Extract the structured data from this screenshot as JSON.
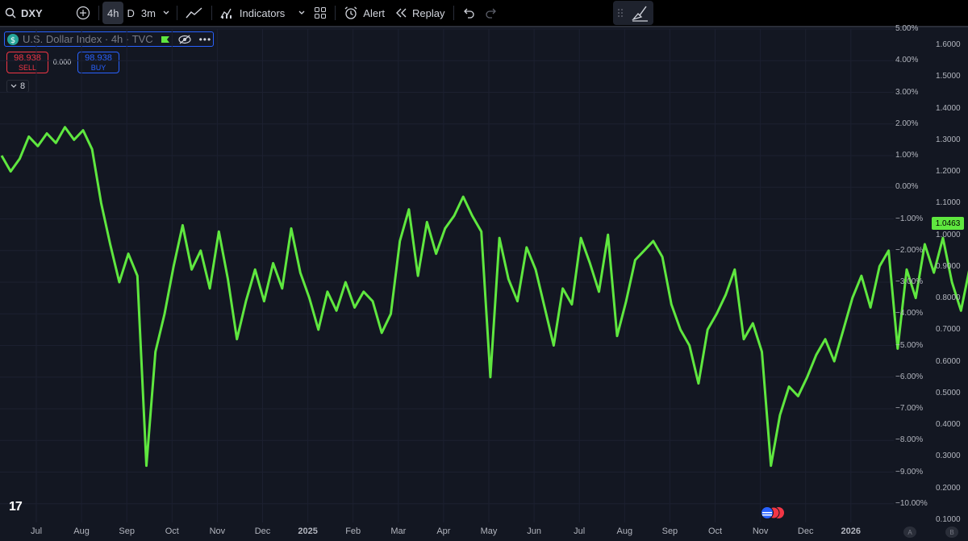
{
  "toolbar": {
    "symbol": "DXY",
    "timeframes": [
      "4h",
      "D",
      "3m"
    ],
    "indicators_label": "Indicators",
    "alert_label": "Alert",
    "replay_label": "Replay"
  },
  "legend": {
    "title": "U.S. Dollar Index · 4h · TVC",
    "sell_price": "98.938",
    "sell_label": "SELL",
    "spread": "0.000",
    "buy_price": "98.938",
    "buy_label": "BUY",
    "collapse_count": "8"
  },
  "price_tag": "1.0463",
  "logo": "17",
  "badges": {
    "a": "A",
    "b": "B"
  },
  "colors": {
    "background": "#131722",
    "line": "#5fe73f",
    "sell": "#f23645",
    "buy": "#2962ff"
  },
  "chart_data": {
    "type": "line",
    "x_ticks": [
      "Jul",
      "Aug",
      "Sep",
      "Oct",
      "Nov",
      "Dec",
      "2025",
      "Feb",
      "Mar",
      "Apr",
      "May",
      "Jun",
      "Jul",
      "Aug",
      "Sep",
      "Oct",
      "Nov",
      "Dec",
      "2026"
    ],
    "y_percent_ticks": [
      "5.00%",
      "4.00%",
      "3.00%",
      "2.00%",
      "1.00%",
      "0.00%",
      "−1.00%",
      "−2.00%",
      "−3.00%",
      "−4.00%",
      "−5.00%",
      "−6.00%",
      "−7.00%",
      "−8.00%",
      "−9.00%",
      "−10.00%"
    ],
    "y_price_ticks": [
      "1.6000",
      "1.5000",
      "1.4000",
      "1.3000",
      "1.2000",
      "1.1000",
      "1.0000",
      "0.9000",
      "0.8000",
      "0.7000",
      "0.6000",
      "0.5000",
      "0.4000",
      "0.3000",
      "0.2000",
      "0.1000"
    ],
    "y_percent_range": [
      -10,
      5
    ],
    "last_value_percent": -1.0,
    "series": [
      {
        "points": [
          [
            0.0,
            1.0
          ],
          [
            0.2,
            0.5
          ],
          [
            0.4,
            0.9
          ],
          [
            0.6,
            1.6
          ],
          [
            0.8,
            1.3
          ],
          [
            1.0,
            1.7
          ],
          [
            1.2,
            1.4
          ],
          [
            1.4,
            1.9
          ],
          [
            1.6,
            1.5
          ],
          [
            1.8,
            1.8
          ],
          [
            2.0,
            1.2
          ],
          [
            2.2,
            -0.5
          ],
          [
            2.4,
            -1.8
          ],
          [
            2.6,
            -3.0
          ],
          [
            2.8,
            -2.1
          ],
          [
            3.0,
            -2.8
          ],
          [
            3.2,
            -8.8
          ],
          [
            3.4,
            -5.2
          ],
          [
            3.6,
            -4.0
          ],
          [
            3.8,
            -2.5
          ],
          [
            4.0,
            -1.2
          ],
          [
            4.2,
            -2.6
          ],
          [
            4.4,
            -2.0
          ],
          [
            4.6,
            -3.2
          ],
          [
            4.8,
            -1.4
          ],
          [
            5.0,
            -2.9
          ],
          [
            5.2,
            -4.8
          ],
          [
            5.4,
            -3.6
          ],
          [
            5.6,
            -2.6
          ],
          [
            5.8,
            -3.6
          ],
          [
            6.0,
            -2.4
          ],
          [
            6.2,
            -3.2
          ],
          [
            6.4,
            -1.3
          ],
          [
            6.6,
            -2.7
          ],
          [
            6.8,
            -3.5
          ],
          [
            7.0,
            -4.5
          ],
          [
            7.2,
            -3.3
          ],
          [
            7.4,
            -3.9
          ],
          [
            7.6,
            -3.0
          ],
          [
            7.8,
            -3.8
          ],
          [
            8.0,
            -3.3
          ],
          [
            8.2,
            -3.6
          ],
          [
            8.4,
            -4.6
          ],
          [
            8.6,
            -4.0
          ],
          [
            8.8,
            -1.7
          ],
          [
            9.0,
            -0.7
          ],
          [
            9.2,
            -2.8
          ],
          [
            9.4,
            -1.1
          ],
          [
            9.6,
            -2.1
          ],
          [
            9.8,
            -1.3
          ],
          [
            10.0,
            -0.9
          ],
          [
            10.2,
            -0.3
          ],
          [
            10.4,
            -0.9
          ],
          [
            10.6,
            -1.4
          ],
          [
            10.8,
            -6.0
          ],
          [
            11.0,
            -1.6
          ],
          [
            11.2,
            -2.9
          ],
          [
            11.4,
            -3.6
          ],
          [
            11.6,
            -1.9
          ],
          [
            11.8,
            -2.6
          ],
          [
            12.0,
            -3.8
          ],
          [
            12.2,
            -5.0
          ],
          [
            12.4,
            -3.2
          ],
          [
            12.6,
            -3.7
          ],
          [
            12.8,
            -1.6
          ],
          [
            13.0,
            -2.4
          ],
          [
            13.2,
            -3.3
          ],
          [
            13.4,
            -1.5
          ],
          [
            13.6,
            -4.7
          ],
          [
            13.8,
            -3.6
          ],
          [
            14.0,
            -2.3
          ],
          [
            14.2,
            -2.0
          ],
          [
            14.4,
            -1.7
          ],
          [
            14.6,
            -2.2
          ],
          [
            14.8,
            -3.7
          ],
          [
            15.0,
            -4.5
          ],
          [
            15.2,
            -5.0
          ],
          [
            15.4,
            -6.2
          ],
          [
            15.6,
            -4.5
          ],
          [
            15.8,
            -4.0
          ],
          [
            16.0,
            -3.4
          ],
          [
            16.2,
            -2.6
          ],
          [
            16.4,
            -4.8
          ],
          [
            16.6,
            -4.3
          ],
          [
            16.8,
            -5.2
          ],
          [
            17.0,
            -8.8
          ],
          [
            17.2,
            -7.2
          ],
          [
            17.4,
            -6.3
          ],
          [
            17.6,
            -6.6
          ],
          [
            17.8,
            -6.0
          ],
          [
            18.0,
            -5.3
          ],
          [
            18.2,
            -4.8
          ],
          [
            18.4,
            -5.5
          ],
          [
            18.6,
            -4.5
          ],
          [
            18.8,
            -3.5
          ],
          [
            19.0,
            -2.8
          ],
          [
            19.2,
            -3.8
          ],
          [
            19.4,
            -2.5
          ],
          [
            19.6,
            -2.0
          ],
          [
            19.8,
            -5.1
          ],
          [
            20.0,
            -2.6
          ],
          [
            20.2,
            -3.5
          ],
          [
            20.4,
            -1.8
          ],
          [
            20.6,
            -2.7
          ],
          [
            20.8,
            -1.6
          ],
          [
            21.0,
            -3.0
          ],
          [
            21.2,
            -3.9
          ],
          [
            21.4,
            -2.5
          ],
          [
            21.6,
            -1.2
          ],
          [
            21.8,
            -2.2
          ],
          [
            22.0,
            -1.5
          ],
          [
            22.2,
            -0.8
          ],
          [
            22.4,
            -2.0
          ],
          [
            22.6,
            -0.7
          ],
          [
            22.8,
            -1.4
          ],
          [
            23.0,
            -0.3
          ],
          [
            23.2,
            -1.3
          ],
          [
            23.4,
            -0.8
          ],
          [
            23.6,
            -0.1
          ],
          [
            23.8,
            -3.8
          ],
          [
            24.0,
            -1.4
          ],
          [
            24.2,
            -0.6
          ],
          [
            24.4,
            -1.0
          ],
          [
            24.6,
            0.2
          ],
          [
            24.8,
            -0.4
          ],
          [
            25.0,
            -1.3
          ],
          [
            25.2,
            0.0
          ],
          [
            25.4,
            0.2
          ],
          [
            25.6,
            -0.6
          ],
          [
            25.8,
            -1.7
          ],
          [
            26.0,
            -0.2
          ],
          [
            26.2,
            -0.9
          ],
          [
            26.4,
            0.1
          ],
          [
            26.6,
            -0.5
          ],
          [
            26.8,
            -0.2
          ],
          [
            27.0,
            -1.0
          ],
          [
            27.2,
            -1.1
          ],
          [
            27.4,
            -1.3
          ],
          [
            27.6,
            -1.0
          ],
          [
            27.8,
            -3.6
          ],
          [
            28.0,
            -2.2
          ],
          [
            28.2,
            -5.2
          ],
          [
            28.4,
            -2.8
          ],
          [
            28.6,
            -3.2
          ],
          [
            28.8,
            -1.9
          ],
          [
            29.0,
            -1.0
          ]
        ]
      }
    ]
  }
}
